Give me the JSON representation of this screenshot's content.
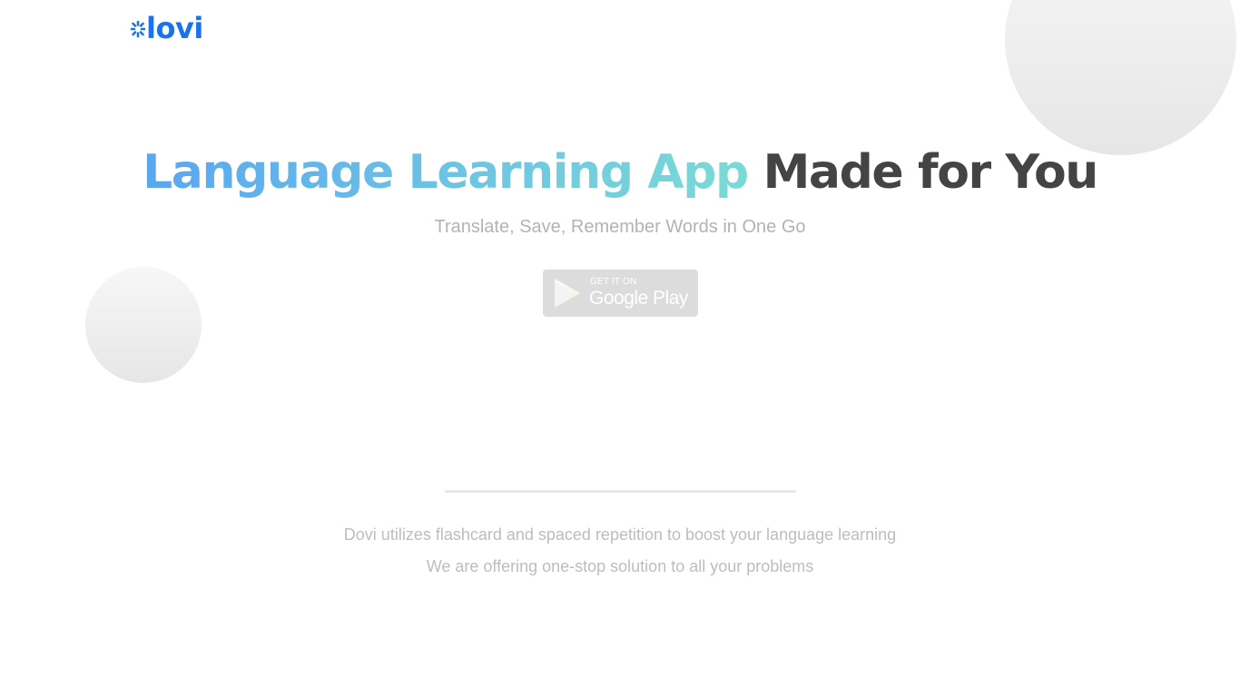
{
  "logo": {
    "text": "lovi",
    "icon": "dotted-burst-icon",
    "color": "#1a73e8"
  },
  "hero": {
    "title_highlight": "Language Learning App",
    "title_rest": "Made for You",
    "subtitle": "Translate, Save, Remember Words in One Go"
  },
  "store_badge": {
    "small_text": "GET IT ON",
    "big_text": "Google Play",
    "icon": "google-play-icon"
  },
  "description": {
    "line1": "Dovi utilizes flashcard and spaced repetition to boost your language learning",
    "line2": "We are offering one-stop solution to all your problems"
  },
  "colors": {
    "gradient_start": "#5aa6f0",
    "gradient_end": "#79dbd5",
    "title_dark": "#444444",
    "muted_text": "#b3b3b3",
    "badge_bg": "#dcdcdc"
  }
}
